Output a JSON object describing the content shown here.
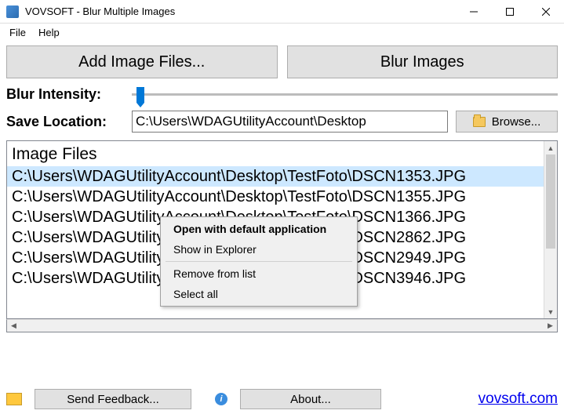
{
  "titlebar": {
    "title": "VOVSOFT - Blur Multiple Images"
  },
  "menubar": {
    "file": "File",
    "help": "Help"
  },
  "buttons": {
    "add": "Add Image Files...",
    "blur": "Blur Images"
  },
  "labels": {
    "intensity": "Blur Intensity:",
    "savelocation": "Save Location:"
  },
  "save": {
    "path": "C:\\Users\\WDAGUtilityAccount\\Desktop",
    "browse": "Browse..."
  },
  "list": {
    "header": "Image Files",
    "items": [
      "C:\\Users\\WDAGUtilityAccount\\Desktop\\TestFoto\\DSCN1353.JPG",
      "C:\\Users\\WDAGUtilityAccount\\Desktop\\TestFoto\\DSCN1355.JPG",
      "C:\\Users\\WDAGUtilityAccount\\Desktop\\TestFoto\\DSCN1366.JPG",
      "C:\\Users\\WDAGUtilityAccount\\Desktop\\TestFoto\\DSCN2862.JPG",
      "C:\\Users\\WDAGUtilityAccount\\Desktop\\TestFoto\\DSCN2949.JPG",
      "C:\\Users\\WDAGUtilityAccount\\Desktop\\TestFoto\\DSCN3946.JPG"
    ]
  },
  "contextmenu": {
    "open": "Open with default application",
    "show": "Show in Explorer",
    "remove": "Remove from list",
    "selectall": "Select all"
  },
  "bottom": {
    "feedback": "Send Feedback...",
    "about": "About...",
    "link": "vovsoft.com"
  }
}
